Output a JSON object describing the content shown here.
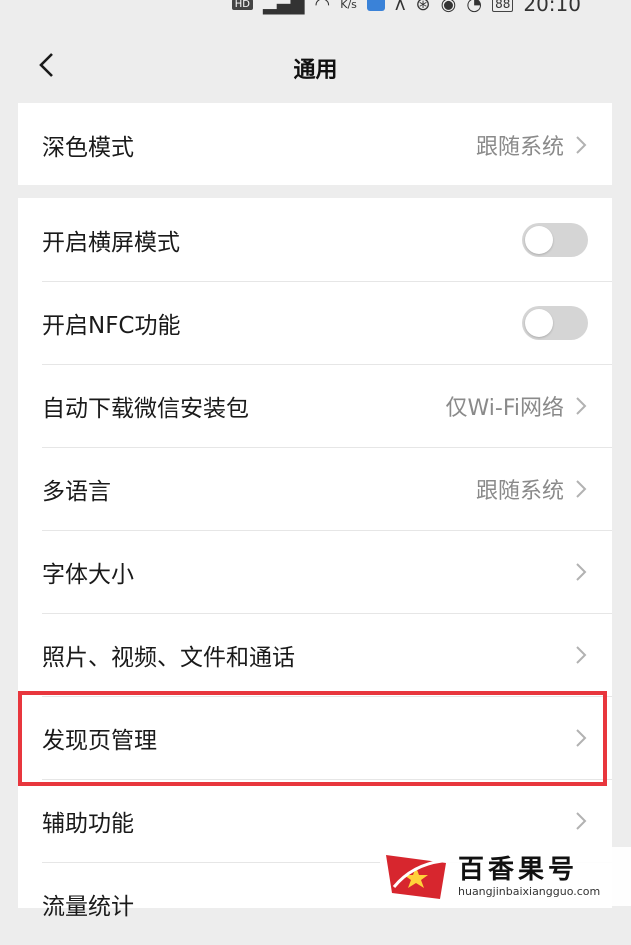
{
  "status_bar": {
    "hd_label": "HD",
    "speed_unit": "K/s",
    "battery": "88",
    "time": "20:10"
  },
  "header": {
    "title": "通用"
  },
  "sections": {
    "display": [
      {
        "label": "深色模式",
        "value": "跟随系统"
      }
    ],
    "general": [
      {
        "label": "开启横屏模式",
        "toggle": false
      },
      {
        "label": "开启NFC功能",
        "toggle": false
      },
      {
        "label": "自动下载微信安装包",
        "value": "仅Wi-Fi网络"
      },
      {
        "label": "多语言",
        "value": "跟随系统"
      },
      {
        "label": "字体大小",
        "value": ""
      },
      {
        "label": "照片、视频、文件和通话",
        "value": ""
      },
      {
        "label": "发现页管理",
        "value": "",
        "highlighted": true
      },
      {
        "label": "辅助功能",
        "value": ""
      },
      {
        "label": "流量统计",
        "value": ""
      }
    ]
  },
  "watermark": {
    "title": "百香果号",
    "url": "huangjinbaixiangguo.com"
  },
  "colors": {
    "background": "#ededed",
    "card": "#ffffff",
    "highlight": "#e8363d",
    "toggle_off": "#d5d5d5",
    "secondary_text": "#8a8a8a"
  }
}
